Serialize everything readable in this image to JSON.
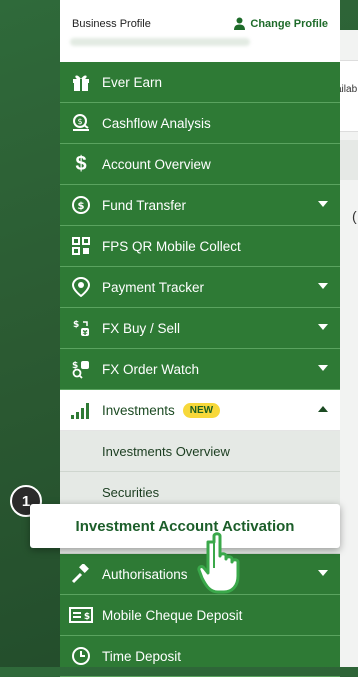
{
  "background": {
    "partial_text": "ailab",
    "mark": "("
  },
  "profile": {
    "label": "Business Profile",
    "change_label": "Change Profile"
  },
  "menu": [
    {
      "id": "ever-earn",
      "label": "Ever Earn",
      "icon": "gift-icon"
    },
    {
      "id": "cashflow",
      "label": "Cashflow Analysis",
      "icon": "magnifier-coin-icon"
    },
    {
      "id": "account-overview",
      "label": "Account Overview",
      "icon": "dollar-icon"
    },
    {
      "id": "fund-transfer",
      "label": "Fund Transfer",
      "icon": "transfer-icon"
    },
    {
      "id": "fps",
      "label": "FPS QR Mobile Collect",
      "icon": "qr-icon"
    },
    {
      "id": "payment-tracker",
      "label": "Payment Tracker",
      "icon": "location-pin-icon"
    },
    {
      "id": "fx-buy-sell",
      "label": "FX Buy / Sell",
      "icon": "currency-exchange-icon"
    },
    {
      "id": "fx-order-watch",
      "label": "FX Order Watch",
      "icon": "currency-search-icon"
    }
  ],
  "investments": {
    "label": "Investments",
    "badge": "NEW",
    "icon": "signal-bars-icon",
    "sub": [
      "Investments Overview",
      "Securities"
    ]
  },
  "highlight": {
    "step": "1",
    "label": "Investment Account Activation"
  },
  "menu_bottom": [
    {
      "id": "authorisations",
      "label": "Authorisations",
      "icon": "gavel-icon"
    },
    {
      "id": "cheque",
      "label": "Mobile Cheque Deposit",
      "icon": "cheque-icon"
    },
    {
      "id": "time-deposit",
      "label": "Time Deposit",
      "icon": "clock-icon"
    }
  ],
  "colors": {
    "brand_green": "#2e7a35",
    "badge_yellow": "#f7d83a"
  }
}
